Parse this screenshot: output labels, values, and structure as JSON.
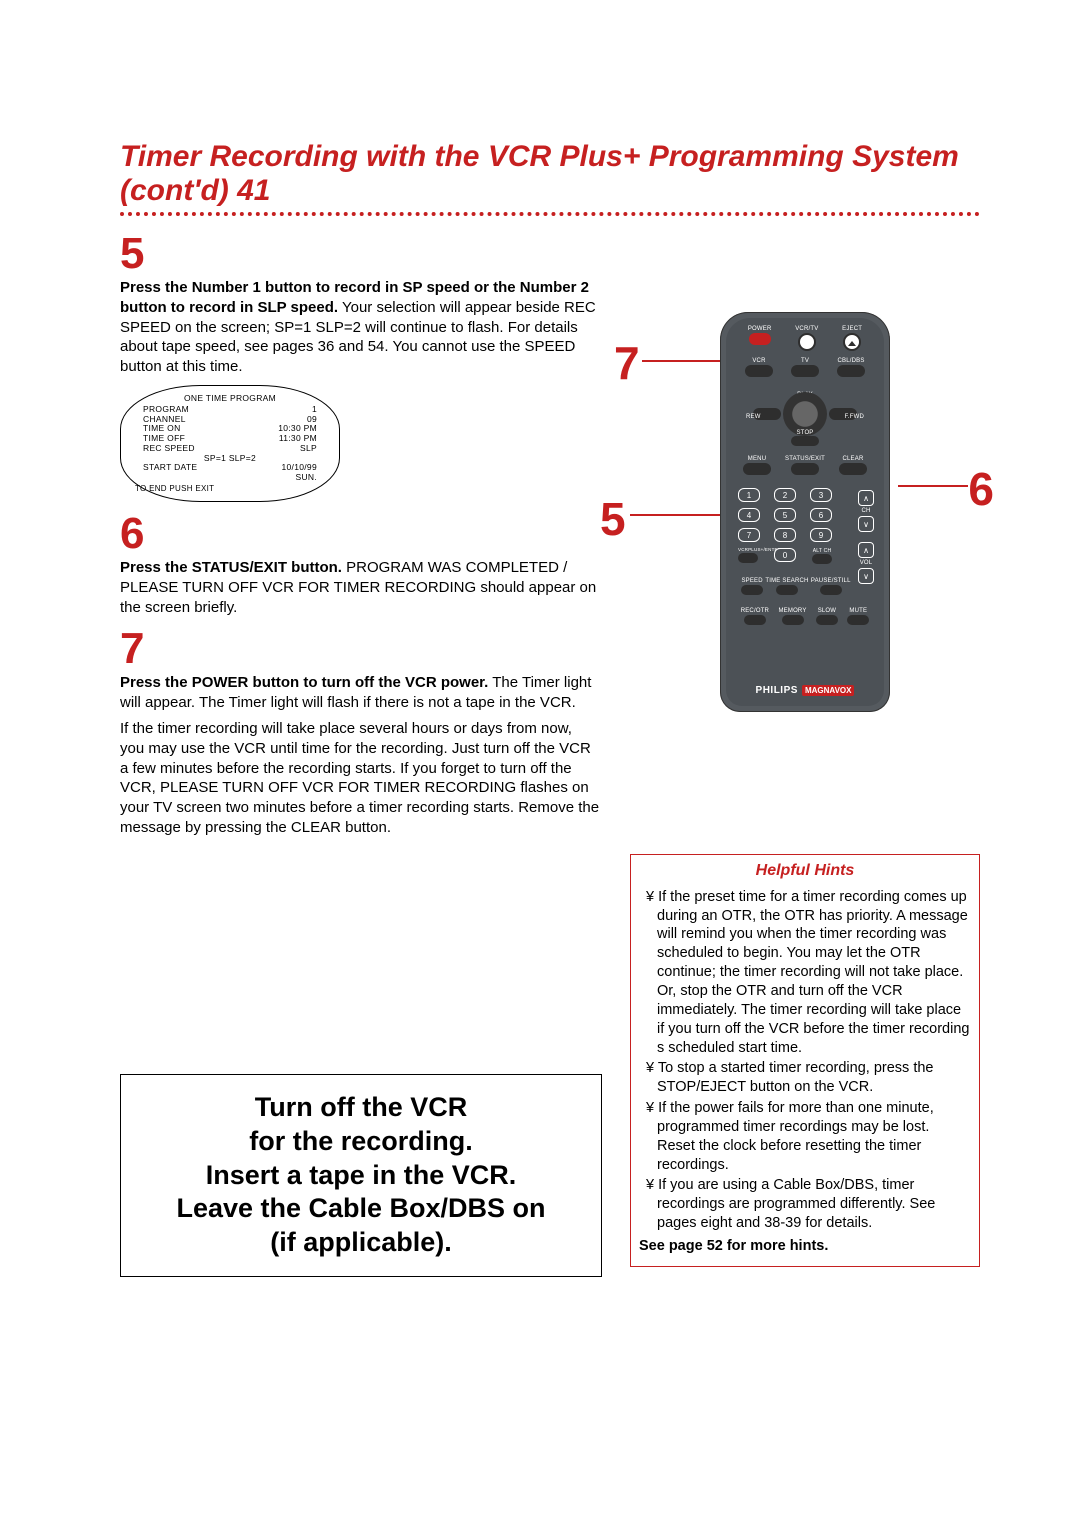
{
  "header": {
    "title": "Timer Recording with the VCR Plus+ Programming System (cont'd)",
    "page_number": "41"
  },
  "steps": {
    "5": {
      "number": "5",
      "bold": "Press the Number 1 button to record in SP speed or the Number 2 button to record in SLP speed.",
      "text": " Your selection will appear beside REC SPEED on the screen; SP=1 SLP=2 will continue to flash. For details about tape speed, see pages 36 and 54. You cannot use the SPEED button at this time."
    },
    "6": {
      "number": "6",
      "bold": "Press the STATUS/EXIT button.",
      "text": " PROGRAM WAS COMPLETED / PLEASE TURN OFF VCR FOR TIMER RECORDING should appear on the screen briefly."
    },
    "7": {
      "number": "7",
      "bold": "Press the POWER button to turn off the VCR power.",
      "text": " The Timer light will appear. The Timer light will flash if there is not a tape in the VCR.",
      "para2": "If the timer recording will take place several hours or days from now, you may use the VCR until time for the recording. Just turn off the VCR a few minutes before the recording starts. If you forget to turn off the VCR, PLEASE TURN OFF VCR FOR TIMER RECORDING flashes on your TV screen two minutes before a timer recording starts. Remove the message by pressing the CLEAR button."
    }
  },
  "osd": {
    "title": "ONE TIME PROGRAM",
    "rows": [
      {
        "label": "PROGRAM",
        "value": "1"
      },
      {
        "label": "CHANNEL",
        "value": "09"
      },
      {
        "label": "TIME ON",
        "value": "10:30 PM"
      },
      {
        "label": "TIME OFF",
        "value": "11:30 PM"
      },
      {
        "label": "REC SPEED",
        "value": "SLP"
      },
      {
        "label": "",
        "value": "SP=1  SLP=2"
      },
      {
        "label": "START DATE",
        "value": "10/10/99"
      },
      {
        "label": "",
        "value": "SUN."
      }
    ],
    "footer": "TO END PUSH EXIT"
  },
  "remote": {
    "callouts": {
      "top_left": "7",
      "mid_left": "5",
      "mid_right": "6"
    },
    "labels": {
      "power": "POWER",
      "vcr_tv": "VCR/TV",
      "eject": "EJECT",
      "vcr": "VCR",
      "tv": "TV",
      "cbl_dbs": "CBL/DBS",
      "play": "PLAY",
      "rew": "REW",
      "ffwd": "F.FWD",
      "stop": "STOP",
      "menu": "MENU",
      "status_exit": "STATUS/EXIT",
      "clear": "CLEAR",
      "ch": "CH",
      "vol": "VOL",
      "vcrplus_enter": "VCRPLUS+/ENTER",
      "alt_ch": "ALT CH",
      "speed": "SPEED",
      "time_search": "TIME SEARCH",
      "pause_still": "PAUSE/STILL",
      "rec_otr": "REC/OTR",
      "memory": "MEMORY",
      "slow": "SLOW",
      "mute": "MUTE"
    },
    "numbers": [
      "1",
      "2",
      "3",
      "4",
      "5",
      "6",
      "7",
      "8",
      "9",
      "0"
    ],
    "brand1": "PHILIPS",
    "brand2": "MAGNAVOX"
  },
  "hints": {
    "title": "Helpful Hints",
    "items": [
      "If the preset time for a timer recording comes up during an OTR, the OTR has priority. A message will remind you when the timer recording was scheduled to begin. You may let the OTR continue; the timer recording will not take place. Or, stop the OTR and turn off the VCR immediately. The timer recording will take place if you turn off the VCR before the timer recording s scheduled start time.",
      "To stop a started timer recording, press the STOP/EJECT button on the VCR.",
      "If the power fails for more than one minute, programmed timer recordings may be lost. Reset the clock before resetting the timer recordings.",
      "If you are using a Cable Box/DBS, timer recordings are programmed differently. See pages eight and 38-39 for details."
    ],
    "footer": "See page 52 for more hints."
  },
  "big_callout": "Turn off the VCR\nfor the recording.\nInsert a tape in the VCR.\nLeave the Cable Box/DBS on\n(if applicable)."
}
